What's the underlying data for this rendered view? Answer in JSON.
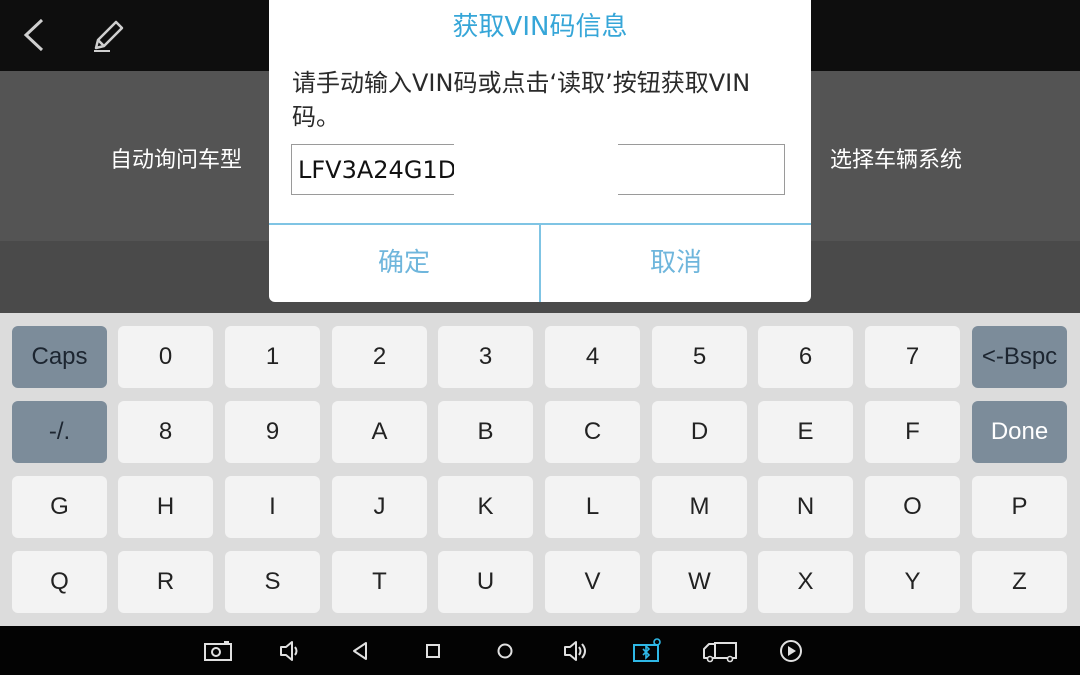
{
  "background": {
    "left_label": "自动询问车型",
    "right_label": "选择车辆系统"
  },
  "dialog": {
    "title": "获取VIN码信息",
    "message": "请手动输入VIN码或点击‘读取’按钮获取VIN码。",
    "vin_value": "LFV3A24G1D",
    "ok_label": "确定",
    "cancel_label": "取消"
  },
  "keyboard": {
    "rows": [
      [
        "Caps",
        "0",
        "1",
        "2",
        "3",
        "4",
        "5",
        "6",
        "7",
        "<-Bspc"
      ],
      [
        "-/.",
        "8",
        "9",
        "A",
        "B",
        "C",
        "D",
        "E",
        "F",
        "Done"
      ],
      [
        "G",
        "H",
        "I",
        "J",
        "K",
        "L",
        "M",
        "N",
        "O",
        "P"
      ],
      [
        "Q",
        "R",
        "S",
        "T",
        "U",
        "V",
        "W",
        "X",
        "Y",
        "Z"
      ]
    ]
  },
  "colors": {
    "accent": "#36a6d8",
    "dark_key": "#7c8c9a"
  },
  "icons": {
    "topbar": [
      "back-arrow-icon",
      "pencil-icon"
    ],
    "navbar": [
      "screenshot-icon",
      "volume-down-icon",
      "back-icon",
      "recent-apps-icon",
      "home-icon",
      "volume-up-icon",
      "vci-connection-icon",
      "truck-icon",
      "play-icon"
    ]
  }
}
